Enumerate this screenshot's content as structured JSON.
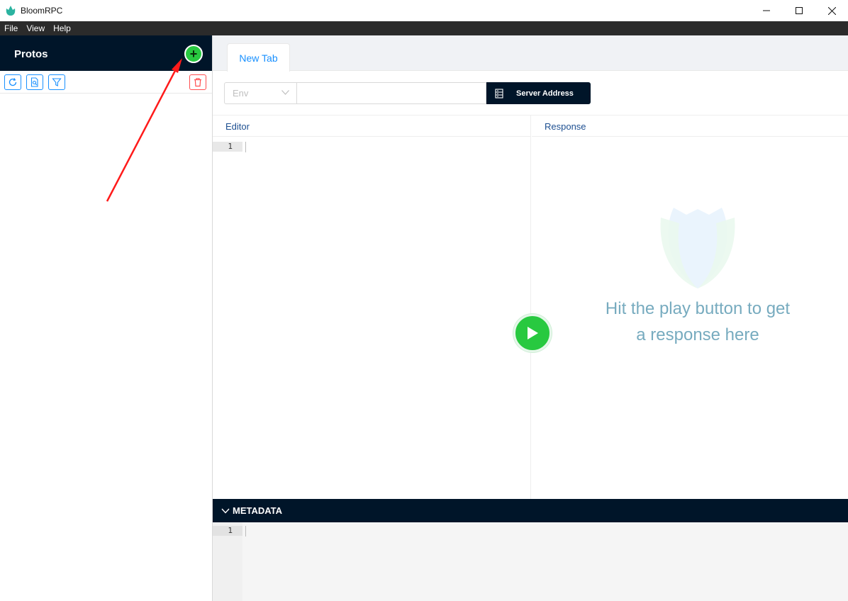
{
  "window": {
    "title": "BloomRPC",
    "icons": {
      "logo": "bloomrpc-logo-icon",
      "minimize": "minimize-icon",
      "maximize": "maximize-icon",
      "close": "close-icon"
    }
  },
  "menu": {
    "items": [
      {
        "label": "File"
      },
      {
        "label": "View"
      },
      {
        "label": "Help"
      }
    ]
  },
  "sidebar": {
    "title": "Protos",
    "add_button": "+",
    "toolbar": [
      {
        "icon": "reload-icon"
      },
      {
        "icon": "file-search-icon"
      },
      {
        "icon": "filter-icon"
      },
      {
        "icon": "delete-icon"
      }
    ]
  },
  "tabs": [
    {
      "label": "New Tab",
      "active": true
    }
  ],
  "address_bar": {
    "env_placeholder": "Env",
    "address_value": "",
    "server_button_label": "Server Address"
  },
  "editor": {
    "title": "Editor",
    "line_number": "1"
  },
  "response": {
    "title": "Response",
    "empty_message": "Hit the play button to get a response here"
  },
  "metadata": {
    "title": "METADATA",
    "line_number": "1"
  },
  "colors": {
    "sidebar_header": "#001529",
    "accent_green": "#28c940",
    "link_blue": "#1890ff",
    "annotation_arrow": "#ff1a1a"
  }
}
